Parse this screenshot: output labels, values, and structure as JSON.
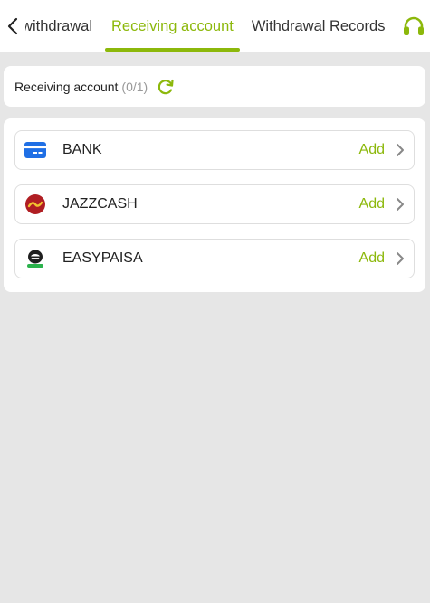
{
  "header": {
    "tabs": [
      {
        "label": "Request withdrawal"
      },
      {
        "label": "Receiving account",
        "active": true
      },
      {
        "label": "Withdrawal Records"
      }
    ],
    "back_icon": "chevron-left-icon",
    "support_icon": "headset-icon"
  },
  "receiving_account": {
    "label": "Receiving account",
    "count": "(0/1)",
    "refresh_icon": "refresh-icon"
  },
  "methods": [
    {
      "name": "BANK",
      "action": "Add",
      "icon": "bank-card-icon"
    },
    {
      "name": "JAZZCASH",
      "action": "Add",
      "icon": "jazzcash-logo-icon"
    },
    {
      "name": "EASYPAISA",
      "action": "Add",
      "icon": "easypaisa-logo-icon"
    }
  ],
  "colors": {
    "accent": "#8cb80b",
    "background": "#e6e6e6",
    "card": "#ffffff",
    "bank_icon": "#1f6fe5",
    "jazzcash_icon": "#b01e23",
    "easypaisa_icon": "#2bb24c"
  }
}
